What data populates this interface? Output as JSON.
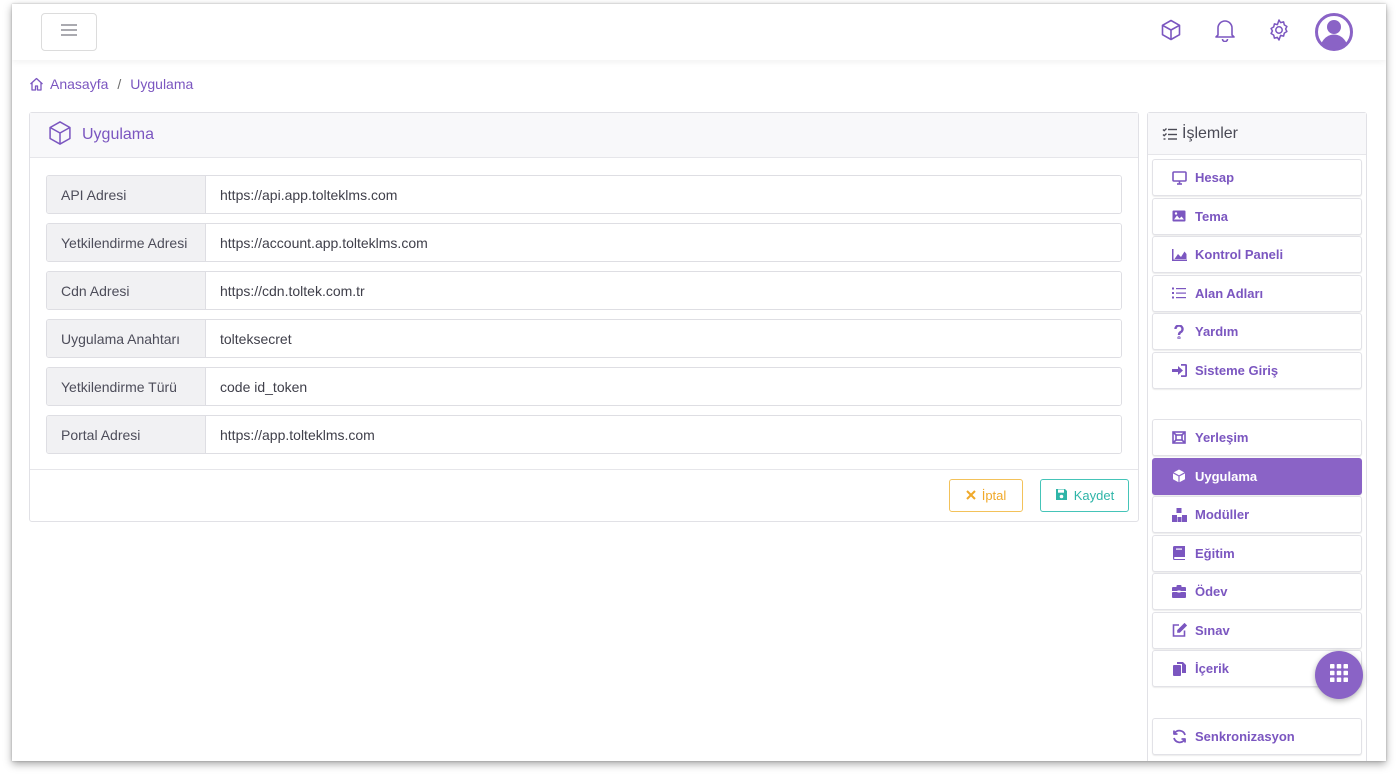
{
  "breadcrumb": {
    "home": "Anasayfa",
    "separator": "/",
    "current": "Uygulama"
  },
  "card": {
    "title": "Uygulama",
    "fields": [
      {
        "label": "API Adresi",
        "value": "https://api.app.tolteklms.com"
      },
      {
        "label": "Yetkilendirme Adresi",
        "value": "https://account.app.tolteklms.com"
      },
      {
        "label": "Cdn Adresi",
        "value": "https://cdn.toltek.com.tr"
      },
      {
        "label": "Uygulama Anahtarı",
        "value": "tolteksecret"
      },
      {
        "label": "Yetkilendirme Türü",
        "value": "code id_token"
      },
      {
        "label": "Portal Adresi",
        "value": "https://app.tolteklms.com"
      }
    ],
    "cancel_label": "İptal",
    "save_label": "Kaydet"
  },
  "sidebar": {
    "title": "İşlemler",
    "groups": [
      [
        {
          "label": "Hesap",
          "icon": "monitor-icon"
        },
        {
          "label": "Tema",
          "icon": "image-icon"
        },
        {
          "label": "Kontrol Paneli",
          "icon": "chart-icon"
        },
        {
          "label": "Alan Adları",
          "icon": "list-icon"
        },
        {
          "label": "Yardım",
          "icon": "question-icon"
        },
        {
          "label": "Sisteme Giriş",
          "icon": "sign-in-icon"
        }
      ],
      [
        {
          "label": "Yerleşim",
          "icon": "layout-icon"
        },
        {
          "label": "Uygulama",
          "icon": "cube-icon",
          "active": true
        },
        {
          "label": "Modüller",
          "icon": "modules-icon"
        },
        {
          "label": "Eğitim",
          "icon": "book-icon"
        },
        {
          "label": "Ödev",
          "icon": "briefcase-icon"
        },
        {
          "label": "Sınav",
          "icon": "edit-icon"
        },
        {
          "label": "İçerik",
          "icon": "copy-icon"
        }
      ],
      [
        {
          "label": "Senkronizasyon",
          "icon": "sync-icon"
        }
      ]
    ]
  },
  "colors": {
    "accent": "#8a63c6",
    "cancel": "#f0a92a",
    "save": "#2fb5a8"
  }
}
